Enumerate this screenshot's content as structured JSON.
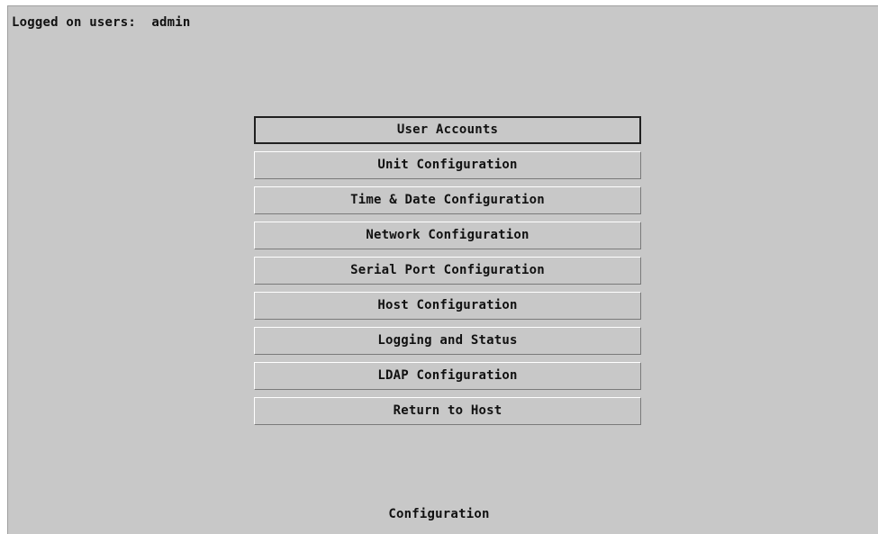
{
  "status": {
    "logged_on_label": "Logged on users:  admin"
  },
  "menu": {
    "items": [
      {
        "label": "User Accounts",
        "selected": true
      },
      {
        "label": "Unit Configuration",
        "selected": false
      },
      {
        "label": "Time & Date Configuration",
        "selected": false
      },
      {
        "label": "Network Configuration",
        "selected": false
      },
      {
        "label": "Serial Port Configuration",
        "selected": false
      },
      {
        "label": "Host Configuration",
        "selected": false
      },
      {
        "label": "Logging and Status",
        "selected": false
      },
      {
        "label": "LDAP Configuration",
        "selected": false
      },
      {
        "label": "Return to Host",
        "selected": false
      }
    ]
  },
  "footer": {
    "title": "Configuration"
  },
  "colors": {
    "background": "#c8c8c8",
    "text": "#111111"
  }
}
